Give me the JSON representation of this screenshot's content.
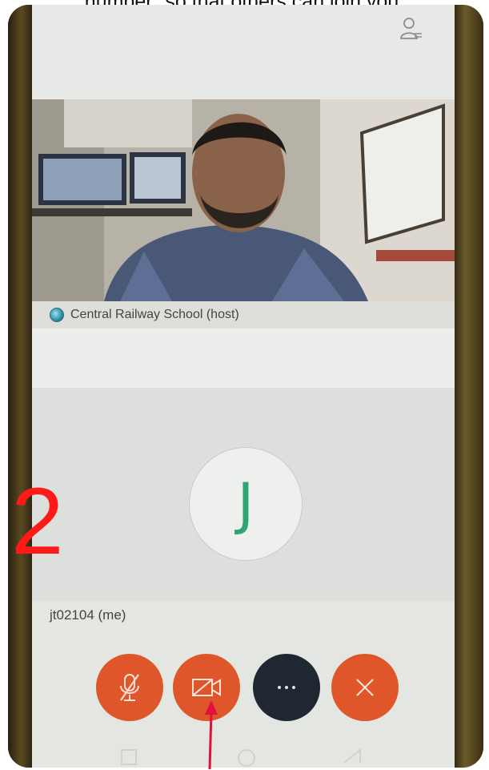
{
  "caption": {
    "text": "number\" so that others can join you."
  },
  "header": {
    "participants_icon": "person-list-icon"
  },
  "video_tile": {
    "host_name": "Central Railway School (host)",
    "status_color": "#2a8ea8"
  },
  "self_tile": {
    "avatar_letter": "J",
    "avatar_color": "#2fa572",
    "name": "jt02104 (me)"
  },
  "controls": [
    {
      "name": "mute",
      "icon": "microphone-muted-icon",
      "color": "#e0562b"
    },
    {
      "name": "video",
      "icon": "video-off-icon",
      "color": "#e0562b"
    },
    {
      "name": "more",
      "icon": "ellipsis-icon",
      "color": "#1f2733"
    },
    {
      "name": "leave",
      "icon": "close-icon",
      "color": "#e0562b"
    }
  ],
  "annotation": {
    "step_number": "2",
    "color": "#ff1a1a"
  }
}
